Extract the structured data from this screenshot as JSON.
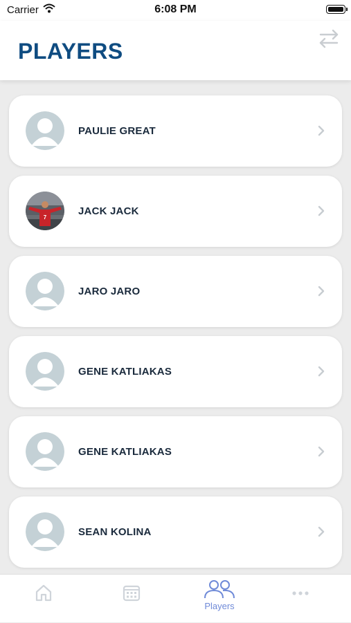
{
  "status_bar": {
    "carrier": "Carrier",
    "time": "6:08 PM"
  },
  "header": {
    "title": "PLAYERS",
    "swap_icon": "swap-arrows-icon"
  },
  "players": [
    {
      "name": "PAULIE GREAT",
      "avatar": "placeholder"
    },
    {
      "name": "JACK JACK",
      "avatar": "photo"
    },
    {
      "name": "JARO JARO",
      "avatar": "placeholder"
    },
    {
      "name": "GENE KATLIAKAS",
      "avatar": "placeholder"
    },
    {
      "name": "GENE KATLIAKAS",
      "avatar": "placeholder"
    },
    {
      "name": "SEAN KOLINA",
      "avatar": "placeholder"
    }
  ],
  "tab_bar": {
    "tabs": [
      {
        "icon": "home-icon",
        "label": "",
        "active": false
      },
      {
        "icon": "calendar-icon",
        "label": "",
        "active": false
      },
      {
        "icon": "players-icon",
        "label": "Players",
        "active": true
      },
      {
        "icon": "more-icon",
        "label": "",
        "active": false
      }
    ]
  },
  "colors": {
    "title": "#0f4c81",
    "active_tab": "#6f8ad8",
    "inactive_tab": "#cfd4da",
    "placeholder_avatar": "#c4d1d6",
    "background": "#ececec"
  }
}
